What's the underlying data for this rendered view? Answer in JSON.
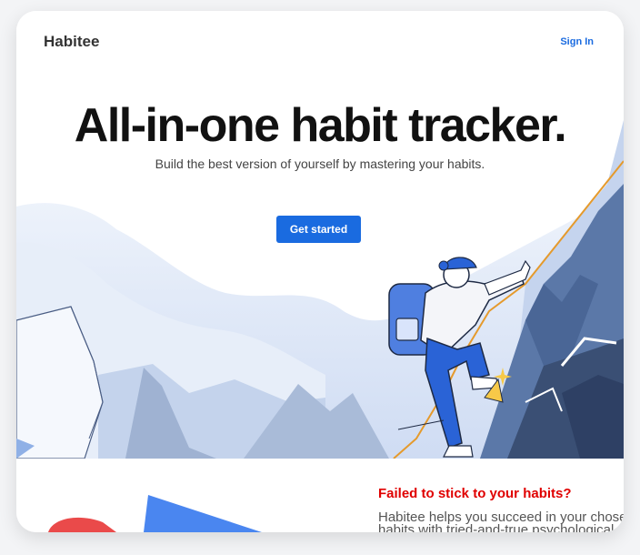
{
  "nav": {
    "brand": "Habitee",
    "sign_in_label": "Sign In"
  },
  "hero": {
    "headline": "All-in-one habit tracker.",
    "subheadline": "Build the best version of yourself by mastering your habits.",
    "cta_label": "Get started"
  },
  "section2": {
    "title": "Failed to stick to your habits?",
    "body": "Habitee helps you succeed in your chosen habits with tried-and-true psychological principles"
  },
  "colors": {
    "accent": "#1a6be0",
    "alert": "#e00000",
    "rock_dark": "#3a4f74",
    "rock_light": "#5b78a8"
  }
}
